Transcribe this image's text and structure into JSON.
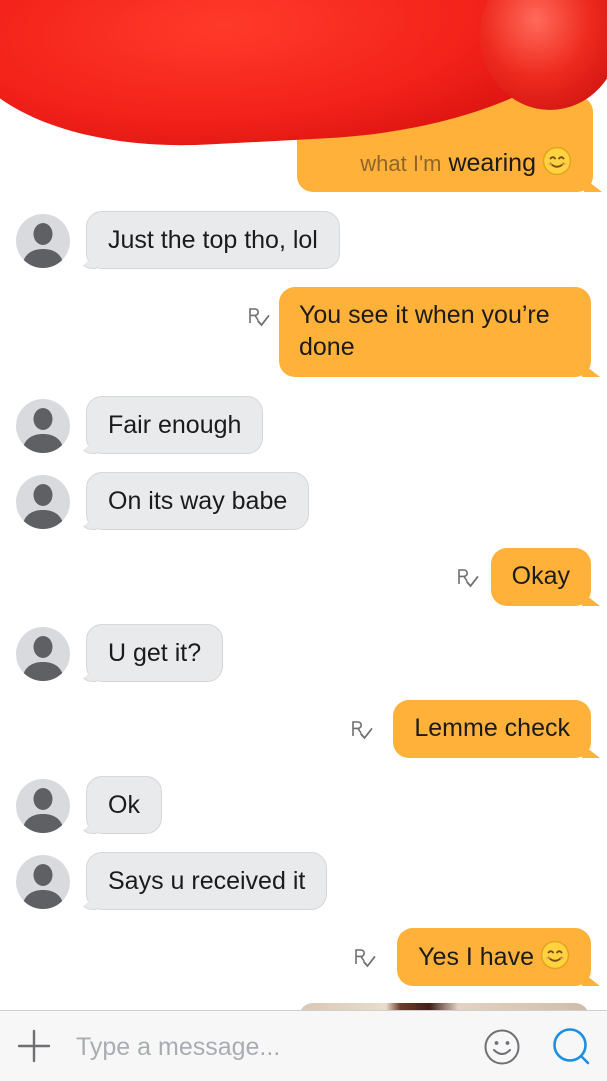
{
  "conversation": {
    "partial_top_message": {
      "text": "wearing",
      "hidden_prefix": "what I'm",
      "emoji": "smiling-face-icon"
    },
    "messages": [
      {
        "from": "them",
        "text": "Just the top tho, lol"
      },
      {
        "from": "me",
        "text": "You see it when you’re done",
        "receipt": "read-receipt-icon"
      },
      {
        "from": "them",
        "text": "Fair enough"
      },
      {
        "from": "them",
        "text": "On its way babe"
      },
      {
        "from": "me",
        "text": "Okay",
        "receipt": "read-receipt-icon"
      },
      {
        "from": "them",
        "text": "U get it?"
      },
      {
        "from": "me",
        "text": "Lemme check",
        "receipt": "read-receipt-icon"
      },
      {
        "from": "them",
        "text": "Ok"
      },
      {
        "from": "them",
        "text": "Says u received it"
      },
      {
        "from": "me",
        "text": "Yes I have",
        "receipt": "read-receipt-icon",
        "emoji": "smiling-face-icon"
      }
    ]
  },
  "composer": {
    "placeholder": "Type a message...",
    "icons": [
      "plus-icon",
      "emoji-icon",
      "send-icon"
    ]
  },
  "colors": {
    "outgoing_bubble": "#ffb13a",
    "incoming_bubble": "#e9eaec",
    "accent": "#1a8fe3",
    "redaction": "#f3221a"
  }
}
